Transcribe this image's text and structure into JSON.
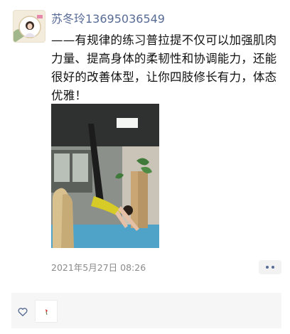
{
  "post": {
    "author": "苏冬玲13695036549",
    "text": "——有规律的练习普拉提不仅可以加强肌肉力量、提高身体的柔韧性和协调能力，还能很好的改善体型，让你四肢修长有力，体态优雅！",
    "timestamp": "2021年5月27日 08:26"
  },
  "icons": {
    "more": "more-dots-icon",
    "like": "heart-outline-icon",
    "photo": "pilates-photo"
  },
  "colors": {
    "name": "#576b95",
    "text": "#111111",
    "time": "#8a8a8a",
    "likes_bg": "#f6f6f6"
  }
}
